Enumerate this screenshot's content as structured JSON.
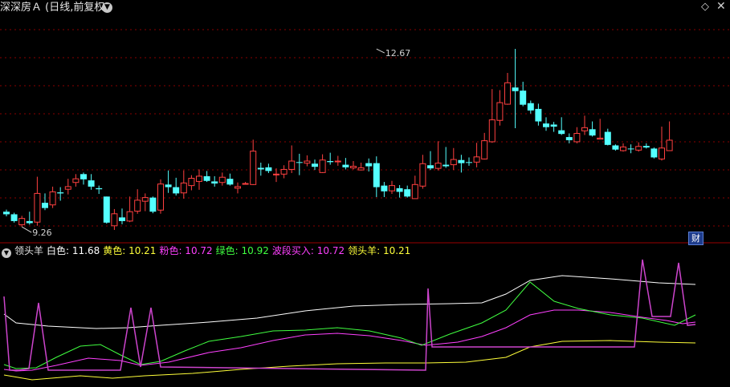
{
  "window": {
    "title": "深深房Ａ (日线,前复权)",
    "title_dropdown_icon": "chevron-down-icon",
    "toolbar_icons": [
      "diamond-icon",
      "close-icon"
    ],
    "toolbar_diamond_glyph": "◇",
    "toolbar_close_glyph": "✕"
  },
  "colors": {
    "up": "#ff4040",
    "down": "#54ffff",
    "grid": "#8a0000",
    "separator": "#9a0000",
    "white_line": "#ffffff",
    "yellow_line": "#ffff3a",
    "pink_line": "#ff40ff",
    "green_line": "#40ff40",
    "purple_line": "#cc44cc",
    "label_text": "#e6e6e6",
    "annotation": "#d0d0d0"
  },
  "main_chart": {
    "annotations": {
      "high": {
        "value": 12.67,
        "label": "12.67",
        "bar_index": 48
      },
      "low": {
        "value": 9.26,
        "label": "9.26",
        "bar_index": 2
      }
    },
    "cai_badge": "财"
  },
  "indicator_panel": {
    "dropdown_icon": "chevron-down-icon",
    "name": "领头羊",
    "items": [
      {
        "label": "白色: 11.68",
        "color": "#ffffff"
      },
      {
        "label": "黄色: 10.21",
        "color": "#ffff3a"
      },
      {
        "label": "粉色: 10.72",
        "color": "#ff40ff"
      },
      {
        "label": "绿色: 10.92",
        "color": "#40ff40"
      },
      {
        "label": "波段买入: 10.72",
        "color": "#ff40ff"
      },
      {
        "label": "领头羊: 10.21",
        "color": "#ffff3a"
      }
    ]
  },
  "chart_data": [
    {
      "type": "candlestick",
      "title": "",
      "y_range": [
        9.0,
        13.3
      ],
      "bars": [
        [
          9.55,
          9.5,
          9.59,
          9.46
        ],
        [
          9.5,
          9.37,
          9.53,
          9.34
        ],
        [
          9.3,
          9.42,
          9.47,
          9.26
        ],
        [
          9.37,
          9.33,
          9.55,
          9.3
        ],
        [
          9.35,
          9.9,
          10.22,
          9.28
        ],
        [
          9.72,
          9.62,
          9.9,
          9.58
        ],
        [
          9.68,
          9.93,
          10.03,
          9.62
        ],
        [
          9.92,
          9.9,
          10.02,
          9.76
        ],
        [
          9.98,
          10.03,
          10.18,
          9.88
        ],
        [
          10.11,
          10.18,
          10.27,
          10.03
        ],
        [
          10.27,
          10.17,
          10.3,
          10.07
        ],
        [
          10.15,
          10.03,
          10.27,
          9.97
        ],
        [
          10.0,
          9.98,
          10.05,
          9.89
        ],
        [
          9.84,
          9.34,
          9.84,
          9.32
        ],
        [
          9.28,
          9.51,
          9.6,
          9.2
        ],
        [
          9.44,
          9.37,
          9.61,
          9.31
        ],
        [
          9.37,
          9.55,
          9.84,
          9.35
        ],
        [
          9.56,
          9.77,
          9.98,
          9.51
        ],
        [
          9.75,
          9.82,
          9.9,
          9.56
        ],
        [
          9.82,
          9.55,
          9.84,
          9.52
        ],
        [
          9.58,
          10.08,
          10.17,
          9.51
        ],
        [
          10.07,
          10.02,
          10.34,
          9.91
        ],
        [
          10.02,
          9.9,
          10.2,
          9.86
        ],
        [
          9.91,
          10.1,
          10.34,
          9.8
        ],
        [
          10.05,
          10.19,
          10.25,
          9.96
        ],
        [
          10.13,
          10.23,
          10.36,
          9.97
        ],
        [
          10.23,
          10.14,
          10.33,
          10.12
        ],
        [
          10.13,
          10.09,
          10.23,
          10.03
        ],
        [
          10.11,
          10.21,
          10.3,
          10.05
        ],
        [
          10.18,
          10.07,
          10.28,
          10.05
        ],
        [
          10.0,
          10.03,
          10.11,
          9.9
        ],
        [
          10.08,
          10.09,
          10.12,
          10.08
        ],
        [
          10.07,
          10.71,
          10.93,
          10.06
        ],
        [
          10.39,
          10.36,
          10.49,
          10.24
        ],
        [
          10.4,
          10.33,
          10.47,
          10.29
        ],
        [
          10.26,
          10.27,
          10.38,
          10.12
        ],
        [
          10.27,
          10.36,
          10.44,
          10.19
        ],
        [
          10.36,
          10.52,
          10.82,
          10.29
        ],
        [
          10.5,
          10.49,
          10.66,
          10.25
        ],
        [
          10.48,
          10.52,
          10.63,
          10.42
        ],
        [
          10.47,
          10.41,
          10.55,
          10.35
        ],
        [
          10.3,
          10.54,
          10.65,
          10.29
        ],
        [
          10.52,
          10.5,
          10.68,
          10.45
        ],
        [
          10.51,
          10.52,
          10.62,
          10.43
        ],
        [
          10.45,
          10.4,
          10.58,
          10.36
        ],
        [
          10.39,
          10.42,
          10.52,
          10.36
        ],
        [
          10.35,
          10.39,
          10.49,
          10.34
        ],
        [
          10.48,
          10.42,
          10.57,
          10.32
        ],
        [
          10.48,
          10.02,
          10.61,
          9.83
        ],
        [
          10.05,
          9.94,
          10.12,
          9.83
        ],
        [
          9.95,
          10.05,
          10.14,
          9.89
        ],
        [
          10.0,
          9.93,
          10.06,
          9.82
        ],
        [
          9.98,
          9.84,
          10.05,
          9.82
        ],
        [
          9.8,
          10.07,
          10.24,
          9.8
        ],
        [
          10.04,
          10.47,
          10.64,
          9.99
        ],
        [
          10.44,
          10.38,
          10.71,
          10.35
        ],
        [
          10.38,
          10.48,
          10.9,
          10.34
        ],
        [
          10.45,
          10.42,
          10.79,
          10.39
        ],
        [
          10.45,
          10.55,
          10.77,
          10.35
        ],
        [
          10.54,
          10.48,
          10.64,
          10.3
        ],
        [
          10.5,
          10.49,
          10.59,
          10.43
        ],
        [
          10.5,
          10.6,
          10.87,
          10.4
        ],
        [
          10.56,
          10.91,
          11.06,
          10.55
        ],
        [
          10.89,
          11.31,
          11.9,
          10.87
        ],
        [
          11.3,
          11.64,
          11.88,
          11.2
        ],
        [
          11.61,
          12.02,
          12.21,
          11.6
        ],
        [
          11.93,
          11.86,
          12.67,
          11.15
        ],
        [
          11.87,
          11.6,
          12.04,
          11.57
        ],
        [
          11.63,
          11.49,
          11.68,
          11.43
        ],
        [
          11.52,
          11.28,
          11.62,
          11.2
        ],
        [
          11.24,
          11.17,
          11.36,
          11.1
        ],
        [
          11.22,
          11.18,
          11.27,
          11.08
        ],
        [
          11.11,
          11.04,
          11.36,
          11.02
        ],
        [
          10.98,
          10.92,
          11.05,
          10.86
        ],
        [
          10.89,
          11.05,
          11.17,
          10.86
        ],
        [
          11.1,
          11.16,
          11.39,
          11.02
        ],
        [
          11.13,
          11.01,
          11.28,
          10.99
        ],
        [
          10.94,
          10.96,
          11.33,
          10.96
        ],
        [
          11.08,
          10.83,
          11.14,
          10.82
        ],
        [
          10.82,
          10.74,
          10.84,
          10.72
        ],
        [
          10.72,
          10.79,
          10.86,
          10.7
        ],
        [
          10.76,
          10.75,
          10.84,
          10.67
        ],
        [
          10.73,
          10.8,
          10.88,
          10.7
        ],
        [
          10.81,
          10.78,
          10.86,
          10.76
        ],
        [
          10.76,
          10.59,
          10.78,
          10.57
        ],
        [
          10.56,
          10.77,
          11.18,
          10.53
        ],
        [
          10.72,
          10.92,
          11.28,
          10.72
        ]
      ]
    },
    {
      "type": "line",
      "title": "领头羊",
      "series_names": [
        "白色",
        "黄色",
        "粉色",
        "绿色"
      ],
      "notes": "indicator lines plus purple 波段买入 spikes"
    }
  ]
}
